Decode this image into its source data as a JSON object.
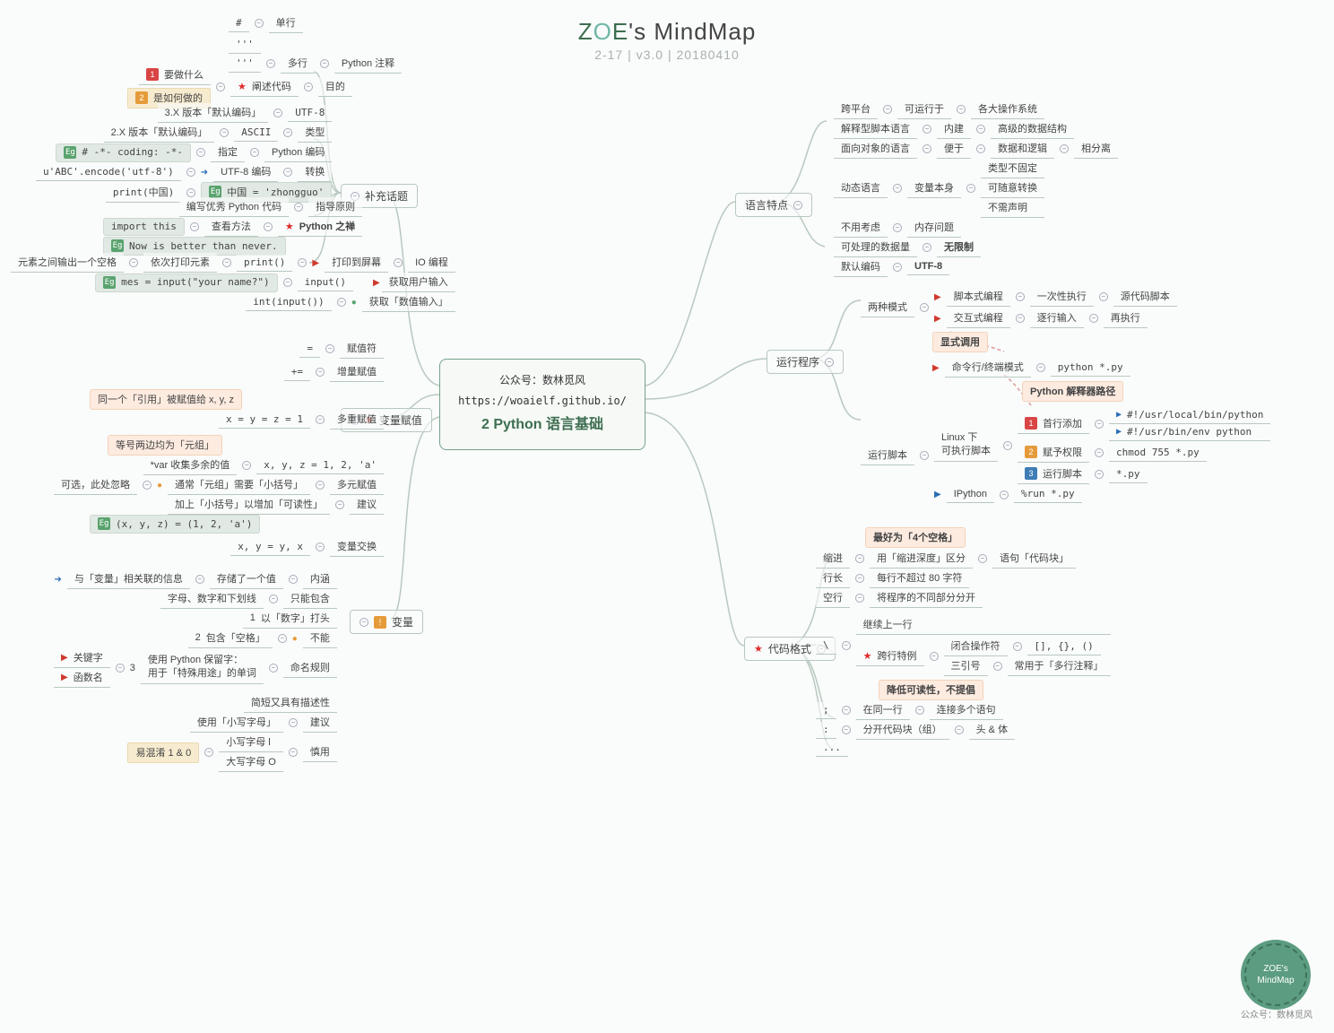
{
  "title": {
    "z": "Z",
    "o": "O",
    "e": "E",
    "rest": "'s MindMap",
    "sub": "2-17 | v3.0 | 20180410"
  },
  "root": {
    "line1": "公众号：数林觅风",
    "line2": "https://woaielf.github.io/",
    "line3_num": "2",
    "line3_txt": " Python 语言基础"
  },
  "l": {
    "buchong": "补充话题",
    "bianliang_fuzhi": "变量赋值",
    "bianliang": "变量",
    "io": "IO 编程",
    "py_zushi": "Python 注释",
    "py_bianma": "Python 编码",
    "py_chan": "Python 之禅",
    "mudi": "目的",
    "miaoshu": "阐述代码",
    "yaozuo": "要做什么",
    "ruhezuo": "是如何做的",
    "danhang": "单行",
    "duohang": "多行",
    "hash": "#",
    "sanyin": "'''",
    "sanyin2": "'''",
    "leixing": "类型",
    "zhiding": "指定",
    "zhuanhuan": "转换",
    "utf8": "UTF-8",
    "ascii": "ASCII",
    "ver3": "3.X 版本「默认编码」",
    "ver2": "2.X 版本「默认编码」",
    "coding": "# -*- coding: -*-",
    "encode": "u'ABC'.encode('utf-8')",
    "utf8bm": "UTF-8 编码",
    "print_zh": "print(中国)",
    "zhongguo": "中国 = 'zhongguo'",
    "zhidao": "指导原则",
    "bianxie": "编写优秀 Python 代码",
    "chakan": "查看方法",
    "import_this": "import this",
    "now": "Now is better than never.",
    "print": "print()",
    "dayin": "打印到屏幕",
    "yici": "依次打印元素",
    "yuansu": "元素之间输出一个空格",
    "input": "input()",
    "mes": "mes = input(\"your name?\")",
    "huoqu": "获取用户输入",
    "int_input": "int(input())",
    "huoqu_shuzhi": "获取「数值输入」",
    "fuzhifu": "赋值符",
    "eq": "=",
    "zengliang": "增量赋值",
    "pluseq": "+=",
    "duochong": "多重赋值",
    "xyz1": "x = y = z = 1",
    "yinyong": "同一个「引用」被赋值给 x, y, z",
    "duoyuan": "多元赋值",
    "var_shouji": "*var 收集多余的值",
    "xyz_list": "x, y, z = 1, 2, 'a'",
    "denghao": "等号两边均为「元组」",
    "kexuan": "可选，此处忽略",
    "tongchang": "通常「元组」需要「小括号」",
    "jianyi": "建议",
    "jiashang": "加上「小括号」以增加「可读性」",
    "xyz_tuple": "(x, y, z) = (1, 2, 'a')",
    "jiaohuan": "变量交换",
    "xy_swap": "x, y = y, x",
    "neihan": "内涵",
    "cunchu": "存储了一个值",
    "guanlian": "与「变量」相关联的信息",
    "mingming": "命名规则",
    "zhineng": "只能包含",
    "zimu": "字母、数字和下划线",
    "buneng": "不能",
    "shuzi": "以「数字」打头",
    "kongge": "包含「空格」",
    "baoliu": "使用 Python 保留字：\n用于「特殊用途」的单词",
    "guanjianzi": "关键字",
    "hanshu": "函数名",
    "jianyi2": "建议",
    "jianduan": "简短又具有描述性",
    "xiaoxie": "使用「小写字母」",
    "shenyong": "慎用",
    "xiaol": "小写字母 l",
    "dao": "大写字母 O",
    "yihunxiao": "易混淆 1 & 0"
  },
  "r": {
    "yuyan": "语言特点",
    "kuaping": "跨平台",
    "keyunxing": "可运行于",
    "gedacos": "各大操作系统",
    "jieshixing": "解释型脚本语言",
    "neijian": "内建",
    "gaoji": "高级的数据结构",
    "mianxiang": "面向对象的语言",
    "bianyu": "便于",
    "shuju": "数据和逻辑",
    "xiangfenli": "相分离",
    "dongtai": "动态语言",
    "bianliang_benshen": "变量本身",
    "leixing_buguding": "类型不固定",
    "kesuiyi": "可随意转换",
    "buxu": "不需声明",
    "buyong": "不用考虑",
    "neicun": "内存问题",
    "kechuli": "可处理的数据量",
    "wuxianzhi": "无限制",
    "moren": "默认编码",
    "utf8b": "UTF-8",
    "yunxing": "运行程序",
    "liangzhong": "两种模式",
    "jiaoben": "脚本式编程",
    "yici_zhixing": "一次性执行",
    "yuandaima": "源代码脚本",
    "jiaohu": "交互式编程",
    "zhuxing": "逐行输入",
    "zai": "再执行",
    "xianshi": "显式调用",
    "mingling": "命令行/终端模式",
    "python_py": "python *.py",
    "jieshiqi": "Python 解释器路径",
    "yunxing_jiaoben": "运行脚本",
    "linux": "Linux 下\n可执行脚本",
    "shouhang": "首行添加",
    "shebang1": "#!/usr/local/bin/python",
    "shebang2": "#!/usr/bin/env python",
    "fuquanxian": "赋予权限",
    "chmod": "chmod 755 *.py",
    "yunxing_jb": "运行脚本",
    "star_py": "*.py",
    "ipython": "IPython",
    "run_py": "%run *.py",
    "daima": "代码格式",
    "suojin": "缩进",
    "yong_suojin": "用「缩进深度」区分",
    "yuju": "语句「代码块」",
    "zuihao": "最好为「4个空格」",
    "hangchang": "行长",
    "meihang": "每行不超过 80 字符",
    "konghang": "空行",
    "jiangchengxu": "将程序的不同部分分开",
    "xiegang": "\\",
    "jixu": "继续上一行",
    "kuahang": "跨行特例",
    "bihe": "闭合操作符",
    "kuohao": "[], {}, ()",
    "sanyin_r": "三引号",
    "changyong": "常用于「多行注释」",
    "jiangdi": "降低可读性，不提倡",
    "fenhao": ";",
    "zaitong": "在同一行",
    "lianjie": "连接多个语句",
    "maohao": ":",
    "fenkai": "分开代码块（组）",
    "toushen": "头 & 体",
    "dots": "..."
  },
  "stamp": {
    "line": "ZOE's\nMindMap",
    "sub": "公众号：数林觅风"
  }
}
